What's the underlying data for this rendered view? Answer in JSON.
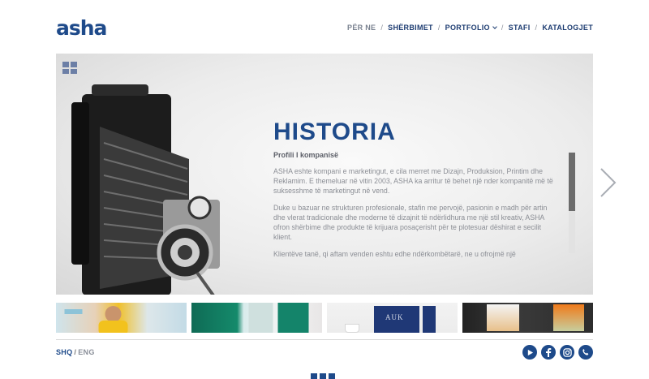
{
  "header": {
    "logo_text": "asha",
    "nav": [
      {
        "label": "PËR NE",
        "active": true
      },
      {
        "label": "SHËRBIMET"
      },
      {
        "label": "PORTFOLIO",
        "has_dropdown": true
      },
      {
        "label": "STAFI"
      },
      {
        "label": "KATALOGJET"
      }
    ],
    "separator": "/"
  },
  "hero": {
    "title": "HISTORIA",
    "subtitle": "Profili I kompanisë",
    "paragraphs": [
      "ASHA eshte kompani e marketingut, e cila merret me Dizajn, Produksion, Printim dhe Reklamim. E themeluar në vitin 2003, ASHA ka arritur të behet një nder kompanitë më të suksesshme të marketingut në vend.",
      "Duke u bazuar ne strukturen profesionale, stafin me pervojë, pasionin e madh për artin dhe vlerat tradicionale dhe moderne të dizajnit të ndërlidhura me një stil kreativ, ASHA ofron shërbime dhe produkte të krijuara posaçerisht për te plotesuar dëshirat e secilit klient.",
      "Klientëve tanë, qi aftam venden eshtu edhe ndërkombëtarë, ne u ofrojmë një"
    ],
    "scroll_position": 0
  },
  "thumbnails": [
    {
      "name": "thumbnail-smiling-man",
      "text": ""
    },
    {
      "name": "thumbnail-green-door",
      "text": ""
    },
    {
      "name": "thumbnail-auk-branding",
      "text": "AUK"
    },
    {
      "name": "thumbnail-poster-display",
      "text": ""
    }
  ],
  "footer": {
    "lang_active": "SHQ",
    "lang_separator": "/",
    "lang_other": "ENG",
    "socials": [
      "play-icon",
      "facebook-icon",
      "instagram-icon",
      "phone-icon"
    ]
  },
  "colors": {
    "brand_blue": "#1e4a8a",
    "nav_text": "#1e3d72",
    "muted_text": "#8b8e95"
  }
}
